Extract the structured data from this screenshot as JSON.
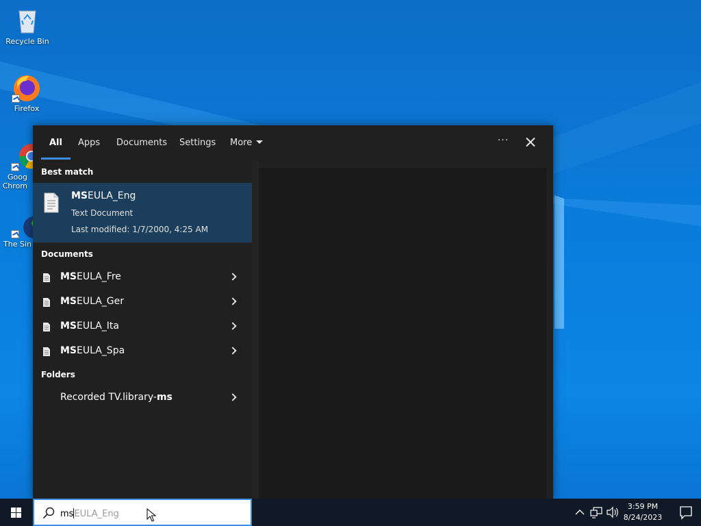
{
  "desktop": {
    "icons": [
      {
        "label": "Recycle Bin"
      },
      {
        "label": "Firefox"
      },
      {
        "label": "Goog Chrom"
      },
      {
        "label": "The Sin"
      }
    ]
  },
  "search_panel": {
    "tabs": [
      {
        "label": "All"
      },
      {
        "label": "Apps"
      },
      {
        "label": "Documents"
      },
      {
        "label": "Settings"
      },
      {
        "label": "More"
      }
    ],
    "more_options_label": "···",
    "best_match": {
      "section_label": "Best match",
      "name_bold": "MS",
      "name_rest": "EULA_Eng",
      "type": "Text Document",
      "modified": "Last modified: 1/7/2000, 4:25 AM"
    },
    "documents": {
      "section_label": "Documents",
      "items": [
        {
          "bold": "MS",
          "rest": "EULA_Fre"
        },
        {
          "bold": "MS",
          "rest": "EULA_Ger"
        },
        {
          "bold": "MS",
          "rest": "EULA_Ita"
        },
        {
          "bold": "MS",
          "rest": "EULA_Spa"
        }
      ]
    },
    "folders": {
      "section_label": "Folders",
      "items": [
        {
          "rest": "Recorded TV.library-",
          "bold": "ms"
        }
      ]
    }
  },
  "taskbar": {
    "search_typed": "ms",
    "search_suggestion": "EULA_Eng",
    "time": "3:59 PM",
    "date": "8/24/2023"
  },
  "colors": {
    "accent": "#3a8ee6",
    "panel_bg": "#202020",
    "selected_bg": "#1b3e5c",
    "taskbar_bg": "#101a26"
  }
}
